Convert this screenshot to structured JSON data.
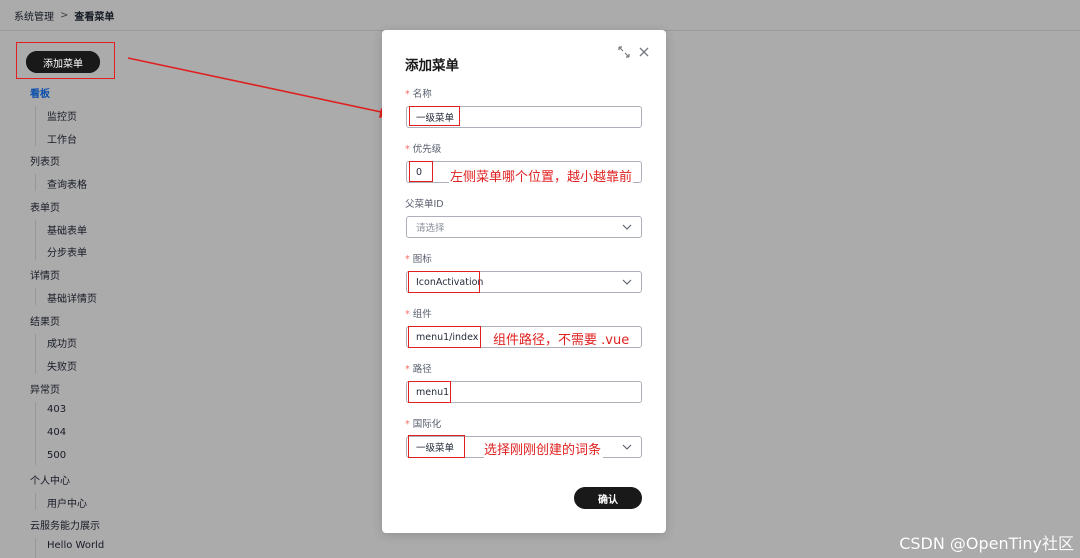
{
  "breadcrumb": {
    "parent": "系统管理",
    "separator": ">",
    "current": "查看菜单"
  },
  "add_button": "添加菜单",
  "menu_tree": {
    "board": "看板",
    "monitor": "监控页",
    "workbench": "工作台",
    "list_page": "列表页",
    "query_table": "查询表格",
    "form_page": "表单页",
    "basic_form": "基础表单",
    "step_form": "分步表单",
    "detail_page": "详情页",
    "basic_detail": "基础详情页",
    "result_page": "结果页",
    "success_page": "成功页",
    "fail_page": "失败页",
    "exception_page": "异常页",
    "e403": "403",
    "e404": "404",
    "e500": "500",
    "personal_center": "个人中心",
    "user_center": "用户中心",
    "cloud_showcase": "云服务能力展示",
    "hello_world": "Hello World"
  },
  "dialog": {
    "title": "添加菜单",
    "name_label": "名称",
    "name_value": "一级菜单",
    "priority_label": "优先级",
    "priority_value": "0",
    "parent_label": "父菜单ID",
    "parent_placeholder": "请选择",
    "icon_label": "图标",
    "icon_value": "IconActivation",
    "component_label": "组件",
    "component_value": "menu1/index",
    "path_label": "路径",
    "path_value": "menu1",
    "i18n_label": "国际化",
    "i18n_value": "一级菜单",
    "confirm_button": "确认"
  },
  "annotations": {
    "priority_note": "左侧菜单哪个位置，越小越靠前",
    "component_note": "组件路径，不需要 .vue",
    "i18n_note": "选择刚刚创建的词条"
  },
  "watermark": "CSDN @OpenTiny社区",
  "colors": {
    "accent": "#1476ff",
    "annotation_red": "#e02020",
    "button_dark": "#191919"
  }
}
